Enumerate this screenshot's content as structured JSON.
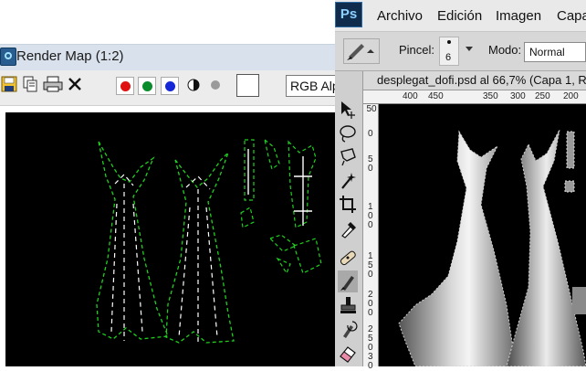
{
  "render_map": {
    "title": "Render Map (1:2)",
    "toolbar": {
      "icons": [
        "save-icon",
        "copy-icon",
        "print-icon",
        "clear-icon"
      ],
      "swatches": [
        {
          "name": "red",
          "color": "#e01010"
        },
        {
          "name": "green",
          "color": "#0a8c2a"
        },
        {
          "name": "blue",
          "color": "#1428d8"
        }
      ],
      "channel_select": "RGB Alpha"
    },
    "canvas": {
      "background": "#000000",
      "wire_color": "#1fd01f",
      "seam_color": "#ffffff"
    }
  },
  "photoshop": {
    "logo": "Ps",
    "menu": [
      "Archivo",
      "Edición",
      "Imagen",
      "Capa"
    ],
    "options_bar": {
      "pincel_label": "Pincel:",
      "pincel_size": "6",
      "modo_label": "Modo:",
      "modo_value": "Normal"
    },
    "document": {
      "title": "desplegat_dofi.psd al 66,7% (Capa 1, R",
      "ruler_top": [
        "400",
        "450",
        "350",
        "300",
        "250",
        "200"
      ],
      "ruler_left": [
        "50",
        "0",
        "5",
        "0",
        "1",
        "0",
        "0",
        "1",
        "5",
        "0",
        "2",
        "0",
        "0",
        "2",
        "5",
        "0",
        "3",
        "0"
      ]
    },
    "tools": [
      "move-icon",
      "lasso-icon",
      "polygon-lasso-icon",
      "magic-wand-icon",
      "crop-icon",
      "eyedropper-icon",
      "healing-brush-icon",
      "brush-icon",
      "stamp-icon",
      "history-brush-icon",
      "eraser-icon"
    ]
  }
}
